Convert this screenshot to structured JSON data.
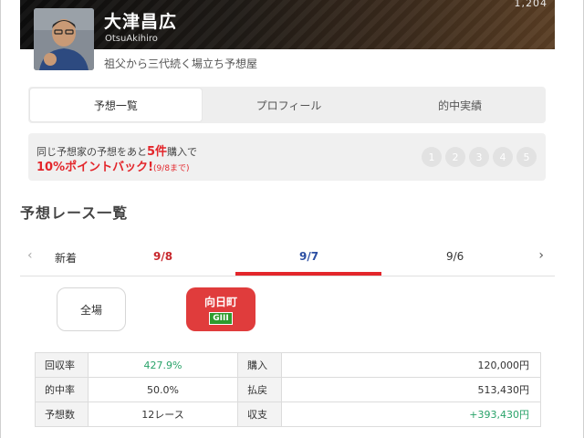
{
  "header": {
    "corner_text": "1,204",
    "name": "大津昌広",
    "name_roman": "OtsuAkihiro",
    "tagline": "祖父から三代続く場立ち予想屋"
  },
  "tabs": [
    {
      "label": "予想一覧",
      "active": true
    },
    {
      "label": "プロフィール",
      "active": false
    },
    {
      "label": "的中実績",
      "active": false
    }
  ],
  "campaign": {
    "line1_pre": "同じ予想家の予想をあと",
    "line1_highlight": "5件",
    "line1_post": "購入で",
    "line2_main": "10%ポイントバック!",
    "line2_small": "(9/8まで)",
    "steps": [
      "1",
      "2",
      "3",
      "4",
      "5"
    ]
  },
  "section_title": "予想レース一覧",
  "date_tabs": {
    "left_arrow": "‹",
    "right_arrow": "›",
    "new": "新着",
    "d1": "9/8",
    "d2": "9/7",
    "d3": "9/6",
    "active": "9/7"
  },
  "venues": {
    "all": "全場",
    "selected": "向日町",
    "selected_grade": "GIII"
  },
  "stats": {
    "recovery_label": "回収率",
    "recovery_value": "427.9%",
    "purchase_label": "購入",
    "purchase_value": "120,000円",
    "hit_label": "的中率",
    "hit_value": "50.0%",
    "payout_label": "払戻",
    "payout_value": "513,430円",
    "count_label": "予想数",
    "count_value": "12レース",
    "balance_label": "収支",
    "balance_value": "+393,430円"
  },
  "colors": {
    "accent_red": "#e3262b",
    "date_blue": "#2b4ea3",
    "positive_green": "#2aa36a",
    "grade_green": "#2e9b2e"
  }
}
